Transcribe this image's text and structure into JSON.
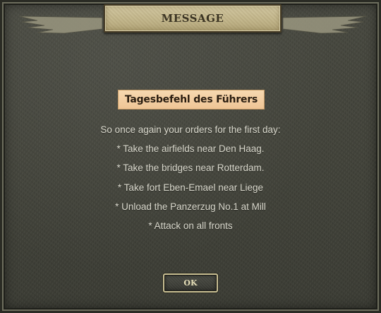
{
  "dialog": {
    "title": "MESSAGE",
    "banner": "Tagesbefehl des Führers",
    "lines": [
      "So once again your orders for the first day:",
      "* Take the airfields near Den Haag.",
      "* Take the bridges near Rotterdam.",
      "* Take fort Eben-Emael near Liege",
      "* Unload the Panzerzug No.1 at Mill",
      "* Attack on all fronts"
    ],
    "ok_label": "OK"
  },
  "colors": {
    "panel": "#45463d",
    "plate": "#c4b88e",
    "banner": "#f2cc9e",
    "text": "#d9d8cc",
    "button_text": "#e6dfb8"
  }
}
